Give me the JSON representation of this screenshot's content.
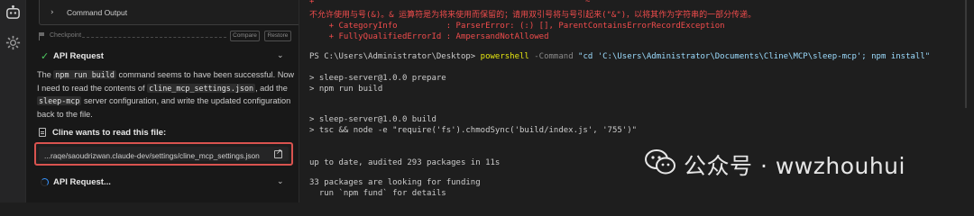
{
  "activity_bar": {
    "icons": [
      "cline-robot-icon",
      "settings-gear-icon"
    ]
  },
  "cline": {
    "command_output_label": "Command Output",
    "checkpoint": {
      "label": "Checkpoint",
      "compare": "Compare",
      "restore": "Restore"
    },
    "api_request_done": "API Request",
    "message": {
      "p1": "The ",
      "code1": "npm run build",
      "p2": " command seems to have been successful. Now I need to read the contents of ",
      "code2": "cline_mcp_settings.json",
      "p3": ", add the ",
      "code3": "sleep-mcp",
      "p4": " server configuration, and write the updated configuration back to the file."
    },
    "wants_read": "Cline wants to read this file:",
    "file_path": "...raqe/saoudrizwan.claude-dev/settings/cline_mcp_settings.json",
    "api_request_pending": "API Request..."
  },
  "terminal": {
    "err_plus": "+",
    "err_tilde": "~",
    "err_msg": "不允许使用与号(&)。& 运算符是为将来使用而保留的；请用双引号将与号引起来(\"&\")，以将其作为字符串的一部分传递。",
    "err_cat": "    + CategoryInfo          : ParserError: (:) [], ParentContainsErrorRecordException",
    "err_fqid": "    + FullyQualifiedErrorId : AmpersandNotAllowed",
    "prompt": "PS C:\\Users\\Administrator\\Desktop> ",
    "cmd": "powershell",
    "cmd_param": " -Command ",
    "cmd_arg": "\"cd 'C:\\Users\\Administrator\\Documents\\Cline\\MCP\\sleep-mcp'; npm install\"",
    "l_prepare": "> sleep-server@1.0.0 prepare",
    "l_build1": "> npm run build",
    "l_build2": "> sleep-server@1.0.0 build",
    "l_tsc": "> tsc && node -e \"require('fs').chmodSync('build/index.js', '755')\"",
    "l_uptodate": "up to date, audited 293 packages in 11s",
    "l_funding": "33 packages are looking for funding",
    "l_fund": "  run `npm fund` for details"
  },
  "watermark": {
    "text": "公众号 · wwzhouhui"
  }
}
